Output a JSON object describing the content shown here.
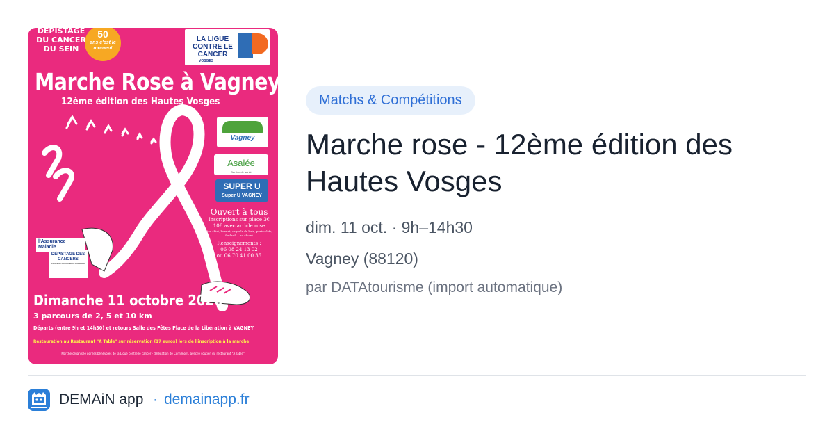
{
  "poster": {
    "top_left": "DEPISTAGE DU CANCER DU SEIN",
    "badge_number": "50",
    "badge_sub": "ans c'est le moment",
    "ligue_text": "LA LIGUE CONTRE LE CANCER",
    "ligue_region": "VOSGES",
    "title": "Marche Rose à Vagney",
    "subtitle": "12ème édition des Hautes Vosges",
    "sponsor_vagney": "Vagney",
    "sponsor_asalee": "Asalée",
    "sponsor_asalee_sub": "Service de santé",
    "sponsor_superu": "SUPER U",
    "sponsor_superu_sub": "Super U VAGNEY",
    "open": "Ouvert à tous",
    "inscriptions": "Inscriptions sur place 3€",
    "article": "10€ avec article rose",
    "article_detail": "(tee shirt, bonnet, cagoule de bain, porte-clefs, foulard ... au choix)",
    "renseignements": "Renseignements :",
    "phone1": "06 08 24 13 02",
    "phone2": "ou 06 70 41 00 35",
    "assurance": "l'Assurance Maladie",
    "depistage_logo": "DÉPISTAGE DES CANCERS",
    "depistage_logo_sub": "Centre de coordination Grand-Est",
    "date": "Dimanche 11 octobre 2026",
    "parcours": "3 parcours de 2, 5 et 10 km",
    "departs": "Départs (entre 9h et 14h30) et retours Salle des Fêtes Place de la Libération à VAGNEY",
    "restauration": "Restauration au Restaurant \"A Table\" sur réservation (17 euros) lors de l'inscription à la marche",
    "footer": "Marche organisée par les bénévoles de la Ligue contre le cancer - délégation de Cornimont, avec le soutien du restaurant \"A Table\""
  },
  "event": {
    "category": "Matchs & Compétitions",
    "title": "Marche rose - 12ème édition des Hautes Vosges",
    "date_time": "dim. 11 oct. · 9h–14h30",
    "location": "Vagney (88120)",
    "author": "par DATAtourisme (import automatique)"
  },
  "footer": {
    "app_name": "DEMAiN app",
    "separator": "·",
    "url": "demainapp.fr"
  },
  "colors": {
    "poster_pink": "#ea2a7e",
    "category_bg": "#e7f0fb",
    "accent_blue": "#2f6fd6"
  },
  "icons": {
    "app": "demain-app-icon"
  }
}
